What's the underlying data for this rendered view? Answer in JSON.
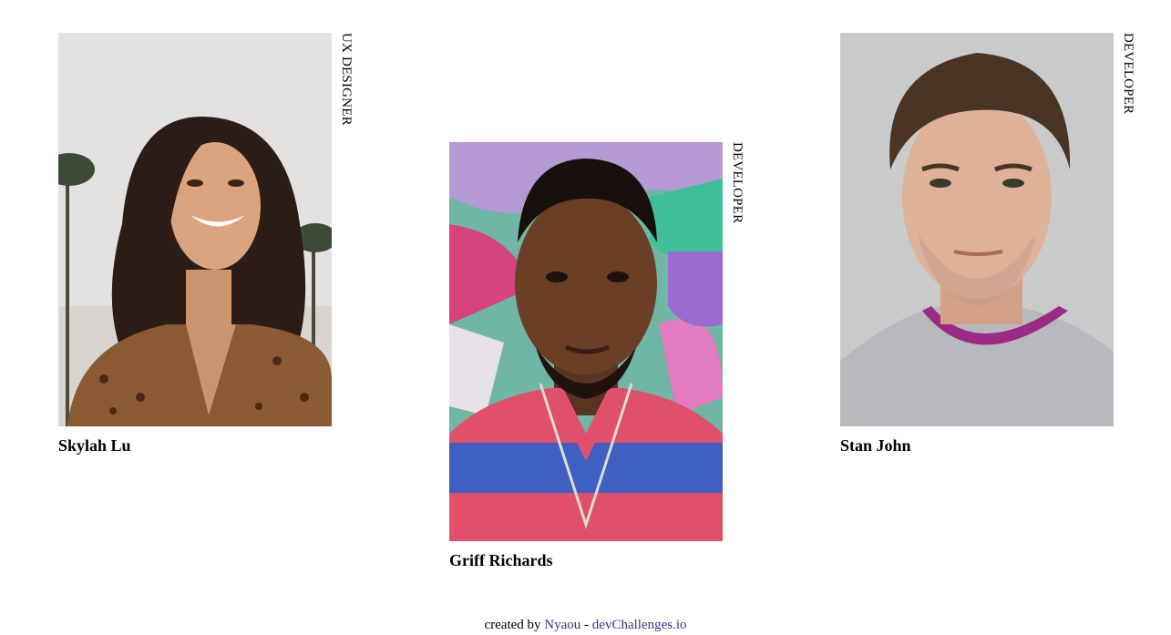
{
  "team": [
    {
      "name": "Skylah Lu",
      "role": "UX DESIGNER",
      "photo_icon": "woman-smiling-portrait-icon"
    },
    {
      "name": "Griff Richards",
      "role": "DEVELOPER",
      "photo_icon": "man-graffiti-portrait-icon"
    },
    {
      "name": "Stan John",
      "role": "DEVELOPER",
      "photo_icon": "man-grey-sweater-portrait-icon"
    }
  ],
  "footer": {
    "prefix": "created by",
    "author": "Nyaou",
    "separator": "-",
    "site": "devChallenges.io"
  },
  "colors": {
    "link": "#4a2b7a",
    "text": "#000000",
    "background": "#ffffff"
  }
}
